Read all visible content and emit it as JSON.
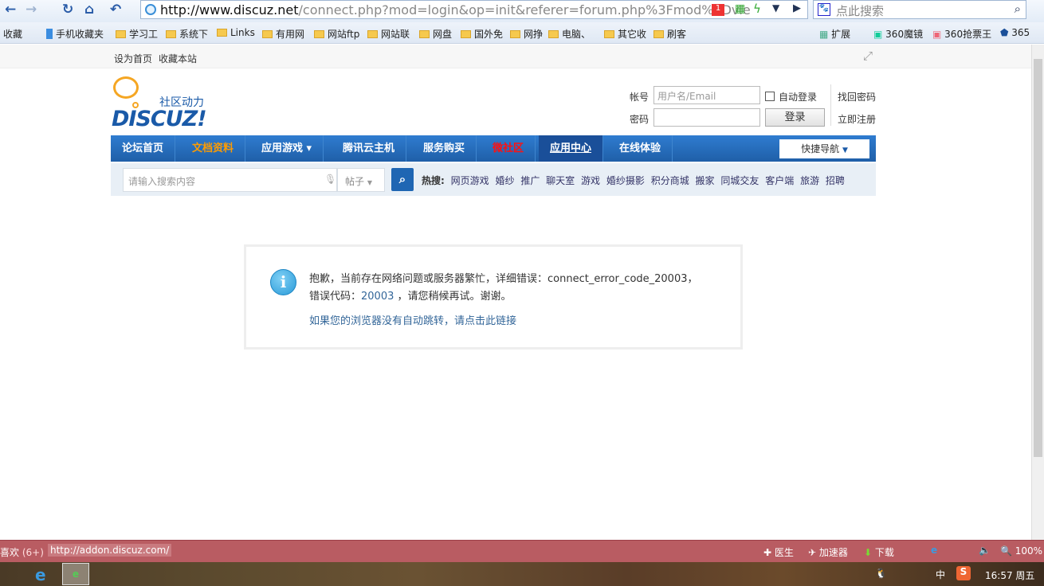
{
  "browser": {
    "url_host": "http://www.discuz.net",
    "url_rest": "/connect.php?mod=login&op=init&referer=forum.php%3Fmod%3Dvie",
    "search_placeholder": "点此搜索",
    "badge_count": "1",
    "bookmarks": [
      "收藏",
      "手机收藏夹",
      "学习工",
      "系统下",
      "Links",
      "有用网",
      "网站ftp",
      "网站联",
      "网盘",
      "国外免",
      "网挣",
      "电脑、",
      "其它收",
      "刷客"
    ],
    "extensions": [
      "扩展",
      "360魔镜",
      "360抢票王",
      "365"
    ]
  },
  "site": {
    "topbar": {
      "set_home": "设为首页",
      "bookmark": "收藏本站"
    },
    "logo": {
      "tagline": "社区动力",
      "name": "DISCUZ!"
    },
    "login": {
      "account_label": "帐号",
      "account_placeholder": "用户名/Email",
      "password_label": "密码",
      "auto_login": "自动登录",
      "login_button": "登录",
      "forgot": "找回密码",
      "register": "立即注册"
    },
    "nav": [
      {
        "label": "论坛首页"
      },
      {
        "label": "文档资料",
        "color": "#ff9c00"
      },
      {
        "label": "应用游戏 ▾"
      },
      {
        "label": "腾讯云主机"
      },
      {
        "label": "服务购买"
      },
      {
        "label": "微社区",
        "color": "#ff0000"
      },
      {
        "label": "应用中心",
        "active": true
      },
      {
        "label": "在线体验"
      }
    ],
    "quick_nav": "快捷导航",
    "search": {
      "placeholder": "请输入搜索内容",
      "type": "帖子",
      "hot_label": "热搜:",
      "hot": [
        "网页游戏",
        "婚纱",
        "推广",
        "聊天室",
        "游戏",
        "婚纱摄影",
        "积分商城",
        "搬家",
        "同城交友",
        "客户端",
        "旅游",
        "招聘"
      ]
    },
    "message": {
      "line1": "抱歉，当前存在网络问题或服务器繁忙，详细错误：connect_error_code_20003，",
      "line2_prefix": "错误代码：",
      "line2_code": "20003",
      "line2_suffix": " ，请您稍候再试。谢谢。",
      "link": "如果您的浏览器没有自动跳转，请点击此链接"
    }
  },
  "statusbar": {
    "left": "喜欢",
    "count": "(6+)",
    "url": "http://addon.discuz.com/",
    "items": [
      "医生",
      "加速器",
      "下载"
    ],
    "zoom": "100%"
  },
  "taskbar": {
    "ime": "中",
    "time": "16:57 周五"
  }
}
